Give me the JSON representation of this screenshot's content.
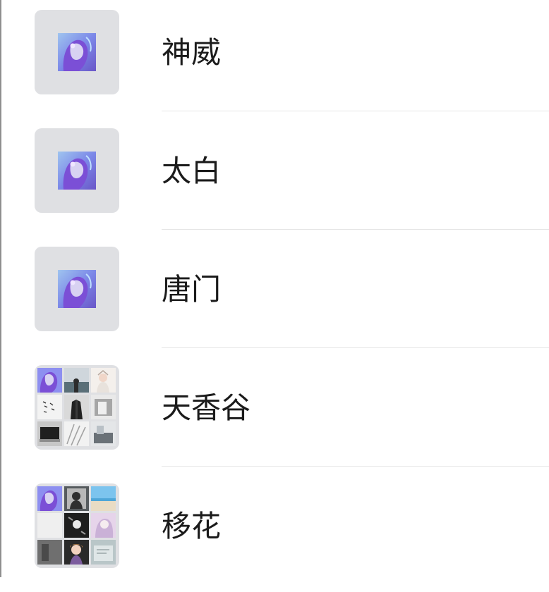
{
  "chat_list": {
    "items": [
      {
        "name": "神威",
        "avatar_type": "single",
        "avatar_icon": "purple-anime-avatar-icon"
      },
      {
        "name": "太白",
        "avatar_type": "single",
        "avatar_icon": "purple-anime-avatar-icon"
      },
      {
        "name": "唐门",
        "avatar_type": "single",
        "avatar_icon": "purple-anime-avatar-icon"
      },
      {
        "name": "天香谷",
        "avatar_type": "group",
        "avatar_icon": "group-avatar-grid-icon"
      },
      {
        "name": "移花",
        "avatar_type": "group",
        "avatar_icon": "group-avatar-grid-icon"
      }
    ]
  },
  "colors": {
    "background": "#ffffff",
    "avatar_background": "#dfe0e3",
    "divider": "#e5e5e5",
    "text": "#1b1b1b"
  }
}
